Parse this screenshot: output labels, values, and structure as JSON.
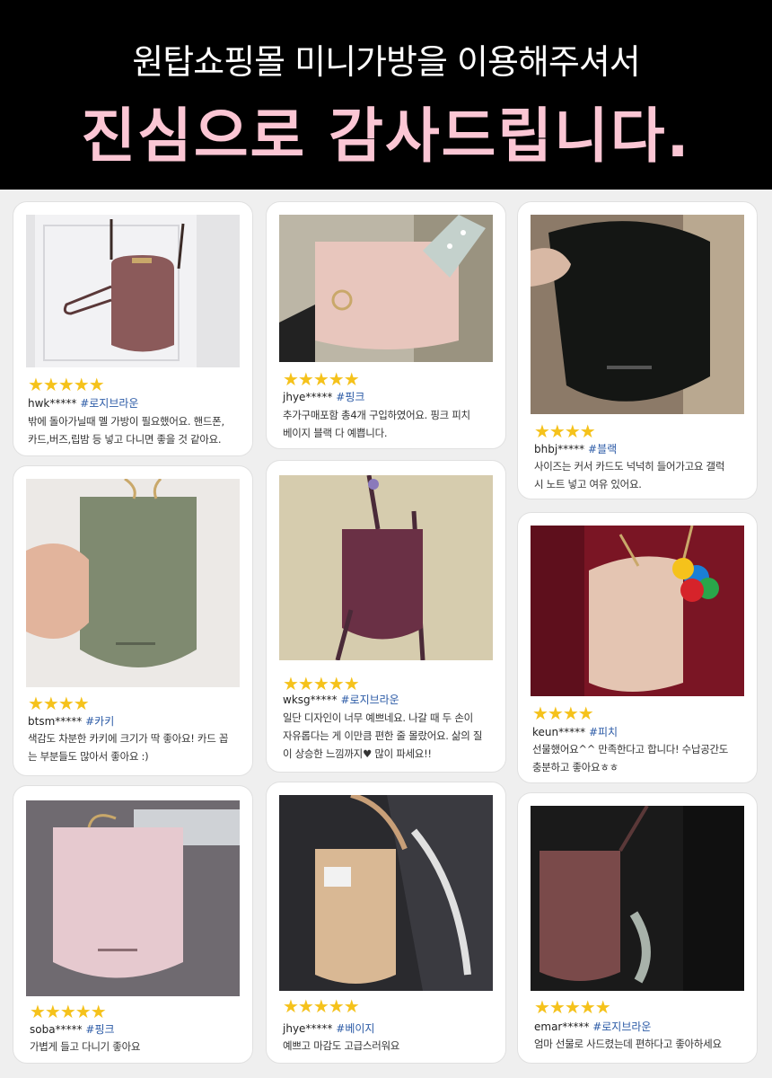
{
  "header": {
    "line1": "원탑쇼핑몰 미니가방을 이용해주셔서",
    "line2": "진심으로 감사드립니다."
  },
  "colors": {
    "header_bg": "#000000",
    "header_accent": "#fbc6d4",
    "star": "#f5c21b",
    "tag": "#2b5aa6"
  },
  "reviews": [
    {
      "user": "hwk*****",
      "tag": "#로지브라운",
      "stars": "★★★★★",
      "photo": "rose-brown crossbody mini bag hanging on door",
      "lines": [
        "밖에 돌아가닐때 멜 가방이 필요했어요. 핸드폰,",
        "카드,버즈,립밤 등 넣고 다니면 좋을 것 같아요."
      ]
    },
    {
      "user": "jhye*****",
      "tag": "#핑크",
      "stars": "★★★★★",
      "photo": "pink mini bag with printed strap",
      "lines": [
        "추가구매포함 총4개 구입하였어요. 핑크 피치",
        "베이지 블랙 다 예쁩니다."
      ]
    },
    {
      "user": "bhbj*****",
      "tag": "#블랙",
      "stars": "★★★★",
      "photo": "black mini bag held in hand",
      "lines": [
        "사이즈는 커서 카드도 넉넉히 들어가고요 갤럭",
        "시 노트 넣고 여유 있어요."
      ]
    },
    {
      "user": "btsm*****",
      "tag": "#카키",
      "stars": "★★★★",
      "photo": "khaki mini bag held in hand",
      "lines": [
        "색감도 차분한 카키에 크기가 딱 좋아요! 카드 꼽",
        "는 부분들도 많아서 좋아요 :)"
      ]
    },
    {
      "user": "wksg*****",
      "tag": "#로지브라운",
      "stars": "★★★★★",
      "photo": "rose-brown mini bag hanging",
      "lines": [
        "일단 디자인이 너무 예쁘네요. 나갈 때 두 손이",
        "자유롭다는 게 이만큼 편한 줄 몰랐어요. 삶의 질",
        "이 상승한 느낌까지♥ 많이 파세요!!"
      ]
    },
    {
      "user": "keun*****",
      "tag": "#피치",
      "stars": "★★★★",
      "photo": "peach mini bag worn on shoulder",
      "lines": [
        "선물했어요^^ 만족한다고 합니다! 수납공간도",
        "충분하고 좋아요ㅎㅎ"
      ]
    },
    {
      "user": "soba*****",
      "tag": "#핑크",
      "stars": "★★★★★",
      "photo": "pink mini bag on table",
      "lines": [
        "가볍게 들고 다니기 좋아요"
      ]
    },
    {
      "user": "jhye*****",
      "tag": "#베이지",
      "stars": "★★★★★",
      "photo": "beige mini bag with card slots",
      "lines": [
        "예쁘고 마감도 고급스러워요"
      ]
    },
    {
      "user": "emar*****",
      "tag": "#로지브라운",
      "stars": "★★★★★",
      "photo": "rose-brown mini bag worn",
      "lines": [
        "엄마 선물로 사드렸는데 편하다고 좋아하세요"
      ]
    }
  ]
}
